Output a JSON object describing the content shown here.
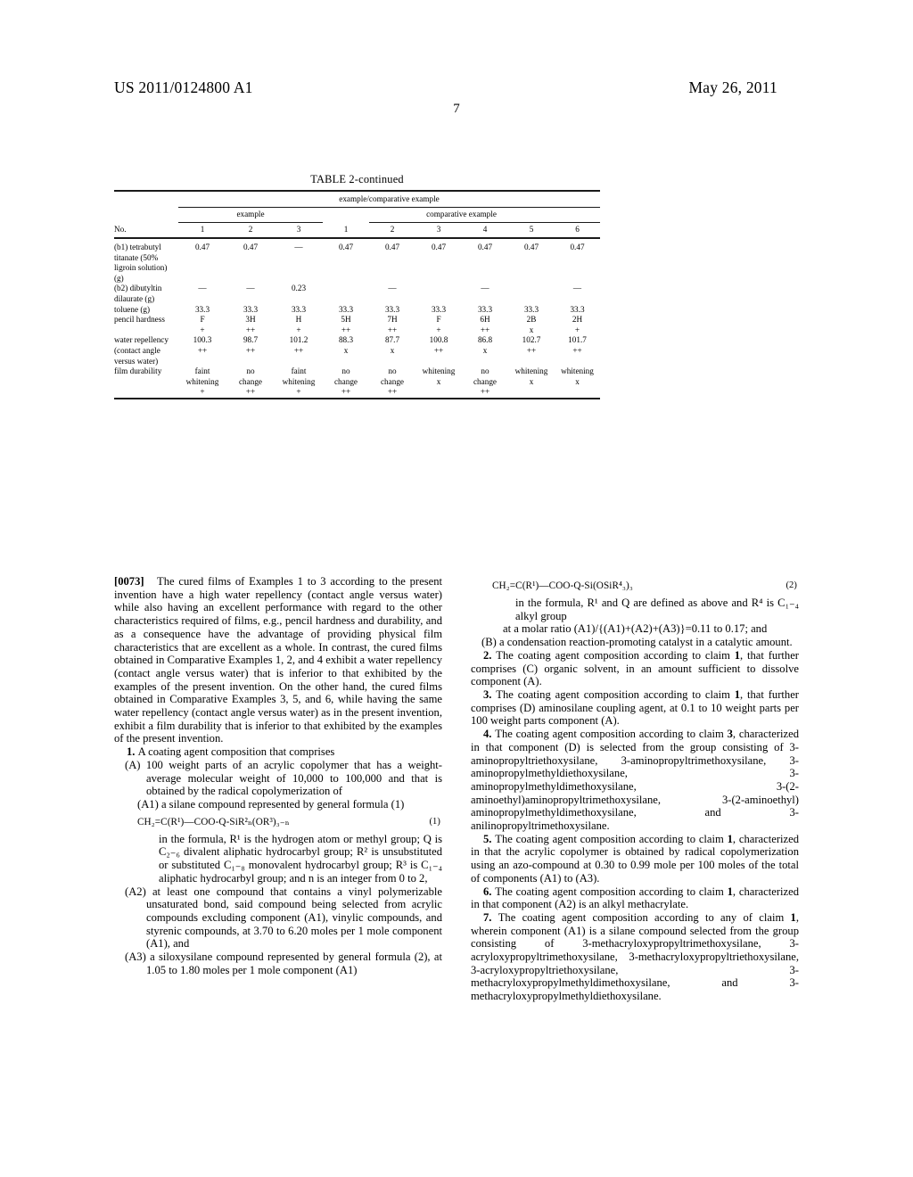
{
  "header": {
    "publication_number": "US 2011/0124800 A1",
    "publication_date": "May 26, 2011",
    "page_number": "7"
  },
  "table": {
    "title": "TABLE 2-continued",
    "span_all": "example/comparative example",
    "group_example": "example",
    "group_comparative": "comparative example",
    "row_label_header": "No.",
    "columns": [
      "1",
      "2",
      "3",
      "1",
      "2",
      "3",
      "4",
      "5",
      "6"
    ],
    "rows": [
      {
        "label": "(b1) tetrabutyl titanate (50% ligroin solution) (g)",
        "values": [
          "0.47",
          "0.47",
          "—",
          "0.47",
          "0.47",
          "0.47",
          "0.47",
          "0.47",
          "0.47"
        ]
      },
      {
        "label": "(b2) dibutyltin dilaurate (g)",
        "values": [
          "—",
          "—",
          "0.23",
          "",
          "—",
          "",
          "—",
          "",
          "—"
        ]
      },
      {
        "label": "toluene (g)",
        "values": [
          "33.3",
          "33.3",
          "33.3",
          "33.3",
          "33.3",
          "33.3",
          "33.3",
          "33.3",
          "33.3"
        ]
      },
      {
        "label": "pencil hardness",
        "values": [
          "F",
          "3H",
          "H",
          "5H",
          "7H",
          "F",
          "6H",
          "2B",
          "2H"
        ],
        "ratings": [
          "+",
          "++",
          "+",
          "++",
          "++",
          "+",
          "++",
          "x",
          "+"
        ]
      },
      {
        "label": "water repellency (contact angle versus water)",
        "values": [
          "100.3",
          "98.7",
          "101.2",
          "88.3",
          "87.7",
          "100.8",
          "86.8",
          "102.7",
          "101.7"
        ],
        "ratings": [
          "++",
          "++",
          "++",
          "x",
          "x",
          "++",
          "x",
          "++",
          "++"
        ]
      },
      {
        "label": "film durability",
        "values_line1": [
          "faint",
          "no",
          "faint",
          "no",
          "no",
          "whitening",
          "no",
          "whitening",
          "whitening"
        ],
        "values_line2": [
          "whitening",
          "change",
          "whitening",
          "change",
          "change",
          "x",
          "change",
          "x",
          "x"
        ],
        "ratings": [
          "+",
          "++",
          "+",
          "++",
          "++",
          "",
          "++",
          "",
          ""
        ]
      }
    ]
  },
  "body": {
    "paragraph_0073": {
      "number": "[0073]",
      "text": "The cured films of Examples 1 to 3 according to the present invention have a high water repellency (contact angle versus water) while also having an excellent performance with regard to the other characteristics required of films, e.g., pencil hardness and durability, and as a consequence have the advantage of providing physical film characteristics that are excellent as a whole. In contrast, the cured films obtained in Comparative Examples 1, 2, and 4 exhibit a water repellency (contact angle versus water) that is inferior to that exhibited by the examples of the present invention. On the other hand, the cured films obtained in Comparative Examples 3, 5, and 6, while having the same water repellency (contact angle versus water) as in the present invention, exhibit a film durability that is inferior to that exhibited by the examples of the present invention."
    },
    "claim1": {
      "number": "1.",
      "preamble": "A coating agent composition that comprises",
      "itemA_tag": "(A)",
      "itemA_text": "100 weight parts of an acrylic copolymer that has a weight-average molecular weight of 10,000 to 100,000 and that is obtained by the radical copolymerization of",
      "itemA1_tag": "(A1)",
      "itemA1_text": "a silane compound represented by general formula (1)",
      "formula1": "CH₂=C(R¹)—COO-Q-SiR²ₙ(OR³)₃₋ₙ",
      "formula1_number": "(1)",
      "formula1_def": "in the formula, R¹ is the hydrogen atom or methyl group; Q is C₂₋₆ divalent aliphatic hydrocarbyl group; R² is unsubstituted or substituted C₁₋₈ monovalent hydrocarbyl group; R³ is C₁₋₄ aliphatic hydrocarbyl group; and n is an integer from 0 to 2,",
      "itemA2_tag": "(A2)",
      "itemA2_text": "at least one compound that contains a vinyl polymerizable unsaturated bond, said compound being selected from acrylic compounds excluding component (A1), vinylic compounds, and styrenic compounds, at 3.70 to 6.20 moles per 1 mole component (A1), and",
      "itemA3_tag": "(A3)",
      "itemA3_text": "a siloxysilane compound represented by general formula (2), at 1.05 to 1.80 moles per 1 mole component (A1)",
      "formula2": "CH₂=C(R¹)—COO-Q-Si(OSiR⁴₃)₃",
      "formula2_number": "(2)",
      "formula2_def": "in the formula, R¹ and Q are defined as above and R⁴ is C₁₋₄ alkyl group",
      "molar_ratio": "at a molar ratio (A1)/{(A1)+(A2)+(A3)}=0.11 to 0.17; and",
      "itemB_tag": "(B)",
      "itemB_text": "a condensation reaction-promoting catalyst in a catalytic amount."
    },
    "claim2": {
      "number": "2.",
      "text_pre": "The coating agent composition according to claim ",
      "ref": "1",
      "text_post": ", that further comprises (C) organic solvent, in an amount sufficient to dissolve component (A)."
    },
    "claim3": {
      "number": "3.",
      "text_pre": "The coating agent composition according to claim ",
      "ref": "1",
      "text_post": ", that further comprises (D) aminosilane coupling agent, at 0.1 to 10 weight parts per 100 weight parts component (A)."
    },
    "claim4": {
      "number": "4.",
      "text_pre": "The coating agent composition according to claim ",
      "ref": "3",
      "text_post": ", characterized in that component (D) is selected from the group consisting of 3-aminopropyltriethoxysilane, 3-aminopropyltrimethoxysilane, 3-aminopropylmethyldiethoxysilane, 3-aminopropylmethyldimethoxysilane, 3-(2-aminoethyl)aminopropyltrimethoxysilane, 3-(2-aminoethyl) aminopropylmethyldimethoxysilane, and 3-anilinopropyltrimethoxysilane."
    },
    "claim5": {
      "number": "5.",
      "text_pre": "The coating agent composition according to claim ",
      "ref": "1",
      "text_post": ", characterized in that the acrylic copolymer is obtained by radical copolymerization using an azo-compound at 0.30 to 0.99 mole per 100 moles of the total of components (A1) to (A3)."
    },
    "claim6": {
      "number": "6.",
      "text_pre": "The coating agent composition according to claim ",
      "ref": "1",
      "text_post": ", characterized in that component (A2) is an alkyl methacrylate."
    },
    "claim7": {
      "number": "7.",
      "text_pre": "The coating agent composition according to any of claim ",
      "ref": "1",
      "text_post": ", wherein component (A1) is a silane compound selected from the group consisting of 3-methacryloxypropyltrimethoxysilane, 3-acryloxypropyltrimethoxysilane, 3-methacryloxypropyltriethoxysilane, 3-acryloxypropyltriethoxysilane, 3-methacryloxypropylmethyldimethoxysilane, and 3-methacryloxypropylmethyldiethoxysilane."
    }
  }
}
